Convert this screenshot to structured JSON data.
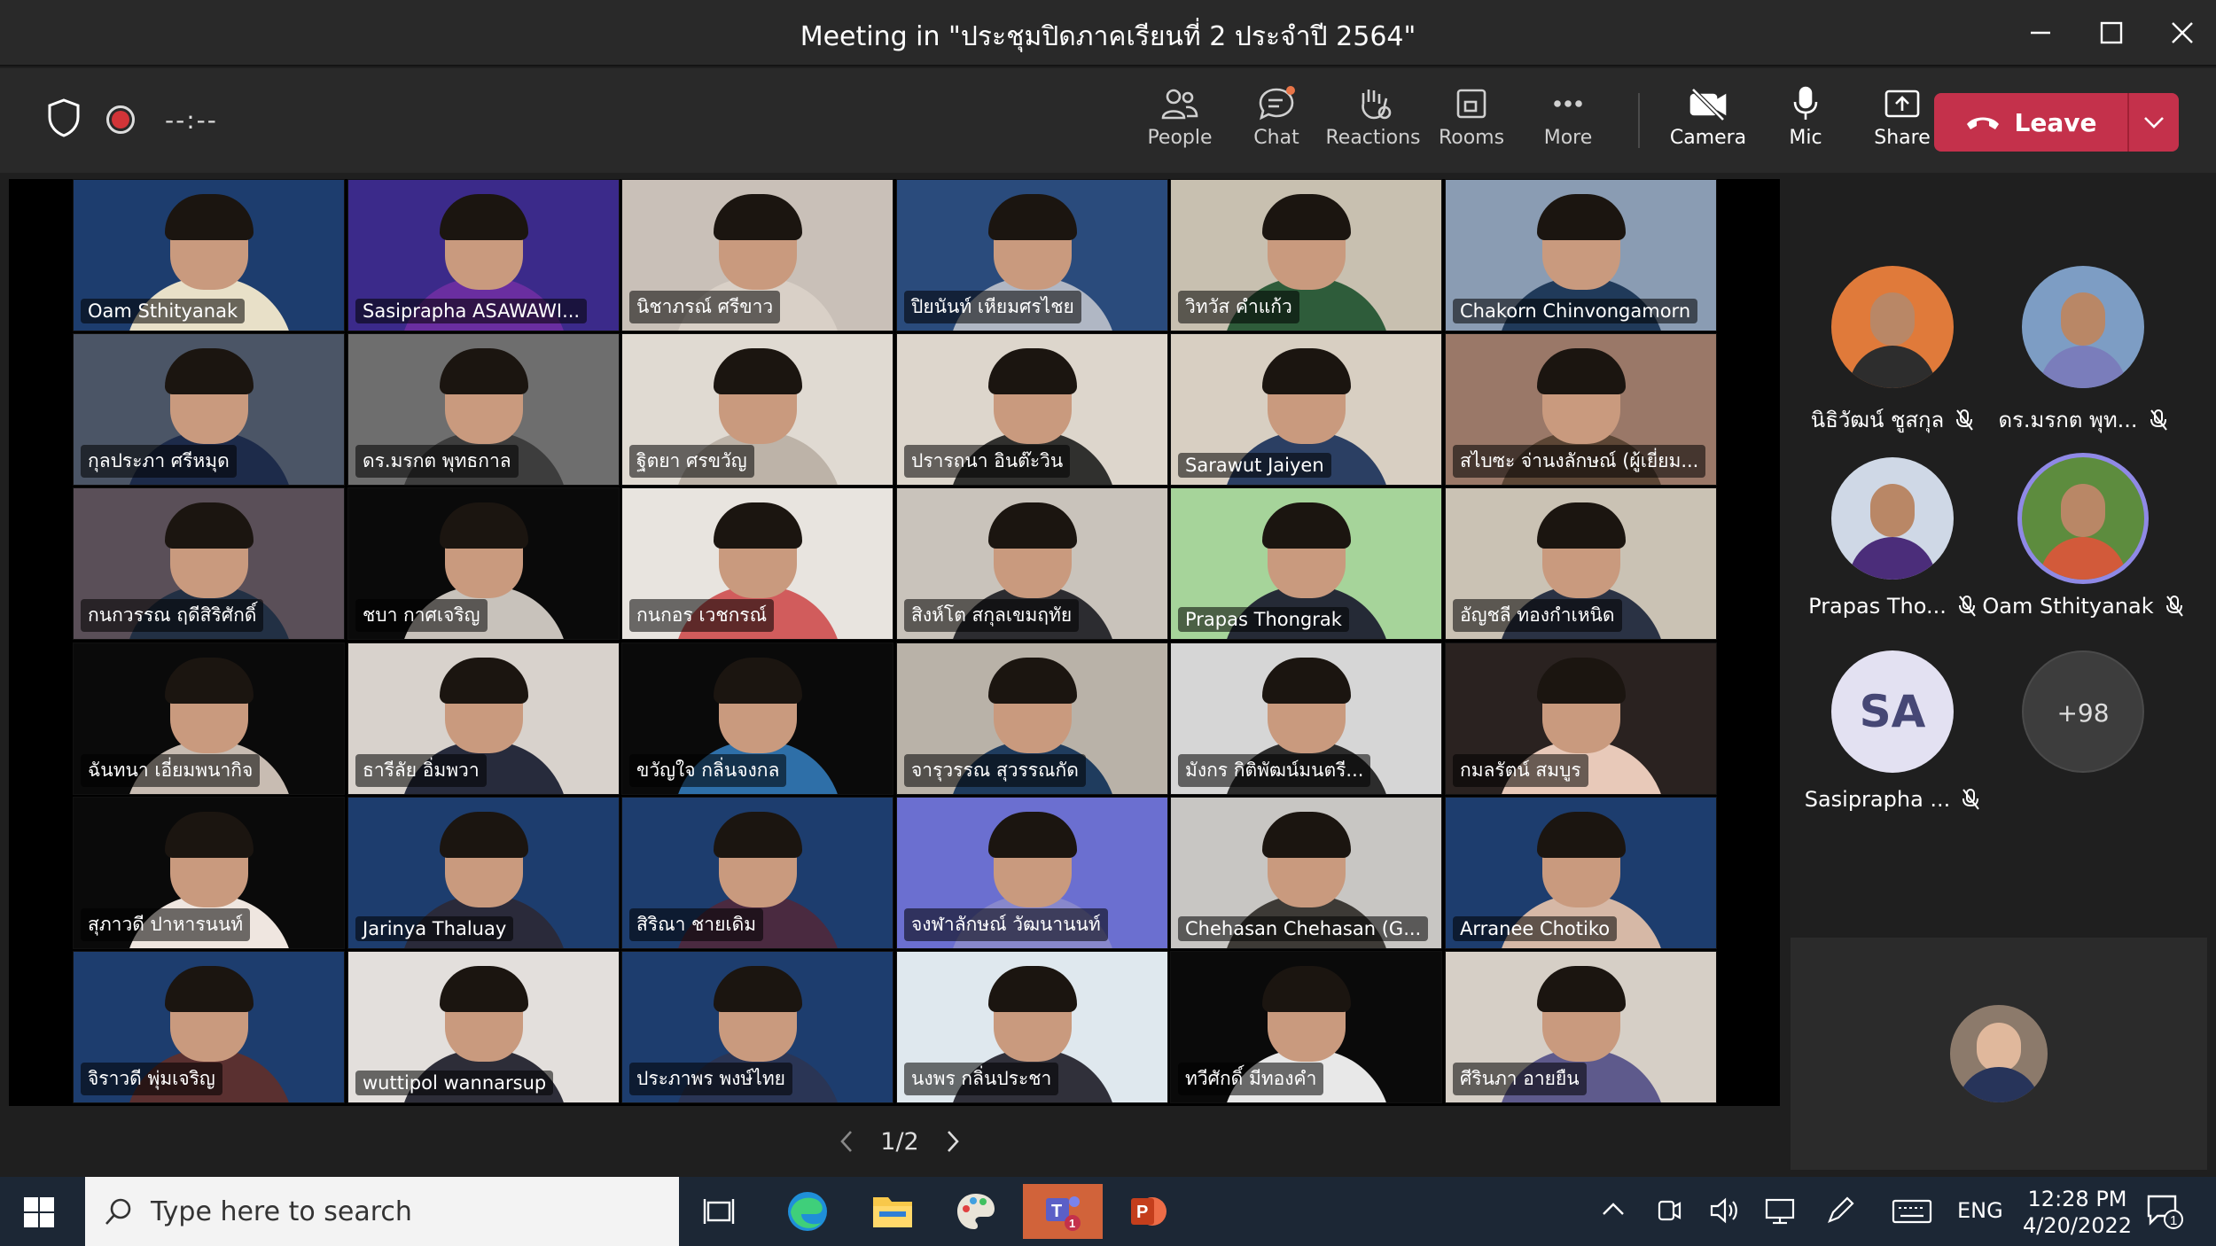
{
  "window": {
    "title": "Meeting in \"ประชุมปิดภาคเรียนที่ 2 ประจำปี 2564\""
  },
  "toolbar": {
    "timer": "--:--",
    "buttons": {
      "people": "People",
      "chat": "Chat",
      "reactions": "Reactions",
      "rooms": "Rooms",
      "more": "More",
      "camera": "Camera",
      "mic": "Mic",
      "share": "Share"
    },
    "leave_label": "Leave",
    "colors": {
      "leave": "#c4314b",
      "record": "#d13438",
      "chat_badge": "#e97548"
    }
  },
  "grid": {
    "tiles": [
      {
        "name": "Oam  Sthityanak",
        "bg": "#1d3d6e",
        "body": "#e8e0c8"
      },
      {
        "name": "Sasiprapha ASAWAWI... ",
        "bg": "#3b2a8a",
        "body": "#6a2ea0"
      },
      {
        "name": "นิชาภรณ์ ศรีขาว",
        "bg": "#c9c0b8",
        "body": "#d9d0c7"
      },
      {
        "name": "ปิยนันท์ เหียมศรไชย",
        "bg": "#2a4b7c",
        "body": "#b0b7c4"
      },
      {
        "name": "วิทวัส คำแก้ว",
        "bg": "#c8c0b0",
        "body": "#2e5c3a"
      },
      {
        "name": "Chakorn Chinvongamorn",
        "bg": "#8a9cb3",
        "body": "#203a5a"
      },
      {
        "name": "กุลประภา ศรีหมุด",
        "bg": "#4b5566",
        "body": "#1d2b4a"
      },
      {
        "name": "ดร.มรกต พุทธกาล",
        "bg": "#6e6e6e",
        "body": "#3d3d3d"
      },
      {
        "name": "ฐิตยา ศรขวัญ",
        "bg": "#e0dad2",
        "body": "#bdb3a8"
      },
      {
        "name": "ปรารถนา อินต๊ะวิน",
        "bg": "#ddd6cc",
        "body": "#30302e"
      },
      {
        "name": "Sarawut  Jaiyen",
        "bg": "#d8cfc2",
        "body": "#2b3f63"
      },
      {
        "name": "สไบซะ จ่านงลักษณ์ (ผู้เยี่ยม...",
        "bg": "#9a7868",
        "body": "#5c4635"
      },
      {
        "name": "กนกวรรณ ฤดีสิริศักดิ์",
        "bg": "#5a4f58",
        "body": "#223044"
      },
      {
        "name": "ชบา กาศเจริญ",
        "bg": "#0a0a0a",
        "body": "#c8c2bb"
      },
      {
        "name": "กนกอร เวชกรณ์",
        "bg": "#e8e4df",
        "body": "#d15c5c"
      },
      {
        "name": "สิงห์โต สกุลเขมฤทัย",
        "bg": "#c9c3bb",
        "body": "#2c2c30"
      },
      {
        "name": "Prapas Thongrak",
        "bg": "#a6d49a",
        "body": "#252a36"
      },
      {
        "name": "อัญชลี ทองกำเหนิด",
        "bg": "#cac2b4",
        "body": "#2a3244"
      },
      {
        "name": "ฉันทนา เอี่ยมพนากิจ",
        "bg": "#0a0a0a",
        "body": "#c8bcb2"
      },
      {
        "name": "ธารีลัย อิ่มพวา",
        "bg": "#d8d2cc",
        "body": "#272b3c"
      },
      {
        "name": "ขวัญใจ กลิ่นจงกล",
        "bg": "#0a0a0a",
        "body": "#2e6fa8"
      },
      {
        "name": "จารุวรรณ สุวรรณกัด",
        "bg": "#b9b2a8",
        "body": "#1f3c5e"
      },
      {
        "name": "มังกร กิติพัฒน์มนตรี...",
        "bg": "#d6d6d6",
        "body": "#2c2c2c"
      },
      {
        "name": "กมลรัตน์ สมบูร",
        "bg": "#2a2220",
        "body": "#e8c9b9"
      },
      {
        "name": "สุภาวดี ปาหารนนท์",
        "bg": "#0a0a0a",
        "body": "#efe6e0"
      },
      {
        "name": "Jarinya Thaluay",
        "bg": "#1d3d6e",
        "body": "#2a2a3a"
      },
      {
        "name": "สิริณา ชายเดิม",
        "bg": "#1d3d6e",
        "body": "#4a2a40"
      },
      {
        "name": "จงฬาลักษณ์ วัฒนานนท์",
        "bg": "#6b6fd0",
        "body": "#8888cc"
      },
      {
        "name": "Chehasan Chehasan (G...",
        "bg": "#c8c6c3",
        "body": "#3d3a36"
      },
      {
        "name": "Arranee Chotiko",
        "bg": "#1d3d6e",
        "body": "#d6b8a6"
      },
      {
        "name": "จิราวดี พุ่มเจริญ",
        "bg": "#1d3d6e",
        "body": "#5a3030"
      },
      {
        "name": "wuttipol wannarsup",
        "bg": "#e3dfdc",
        "body": "#2d2d38"
      },
      {
        "name": "ประภาพร พงษ์ไทย",
        "bg": "#1d3d6e",
        "body": "#2a3555"
      },
      {
        "name": "นงพร กลิ่นประชา",
        "bg": "#dfe8ee",
        "body": "#30303a"
      },
      {
        "name": "ทวีศักดิ์ มีทองคำ",
        "bg": "#0a0a0a",
        "body": "#e8e8e8"
      },
      {
        "name": "ศีรินภา อายยืน",
        "bg": "#d6cfc6",
        "body": "#5e5a8c"
      }
    ]
  },
  "pager": {
    "label": "1/2"
  },
  "roster": {
    "people": [
      {
        "name": "นิธิวัฒน์ ชูสกุล",
        "kind": "photo",
        "bg": "#e07a3a",
        "body": "#2d2d2d"
      },
      {
        "name": "ดร.มรกต พุท...",
        "kind": "photo",
        "bg": "#7d9dc4",
        "body": "#7a7dbb"
      },
      {
        "name": "Prapas Tho...",
        "kind": "photo",
        "bg": "#cfd8e6",
        "body": "#4b2d7a"
      },
      {
        "name": "Oam Sthityanak",
        "kind": "photo",
        "bg": "#5d8c3e",
        "body": "#d25a3a"
      },
      {
        "name": "Sasiprapha ...",
        "kind": "initials",
        "initials": "SA"
      },
      {
        "name": "",
        "kind": "more",
        "count": "+98"
      }
    ]
  },
  "taskbar": {
    "search_placeholder": "Type here to search",
    "language": "ENG",
    "time": "12:28 PM",
    "date": "4/20/2022",
    "notification_count": "1"
  }
}
